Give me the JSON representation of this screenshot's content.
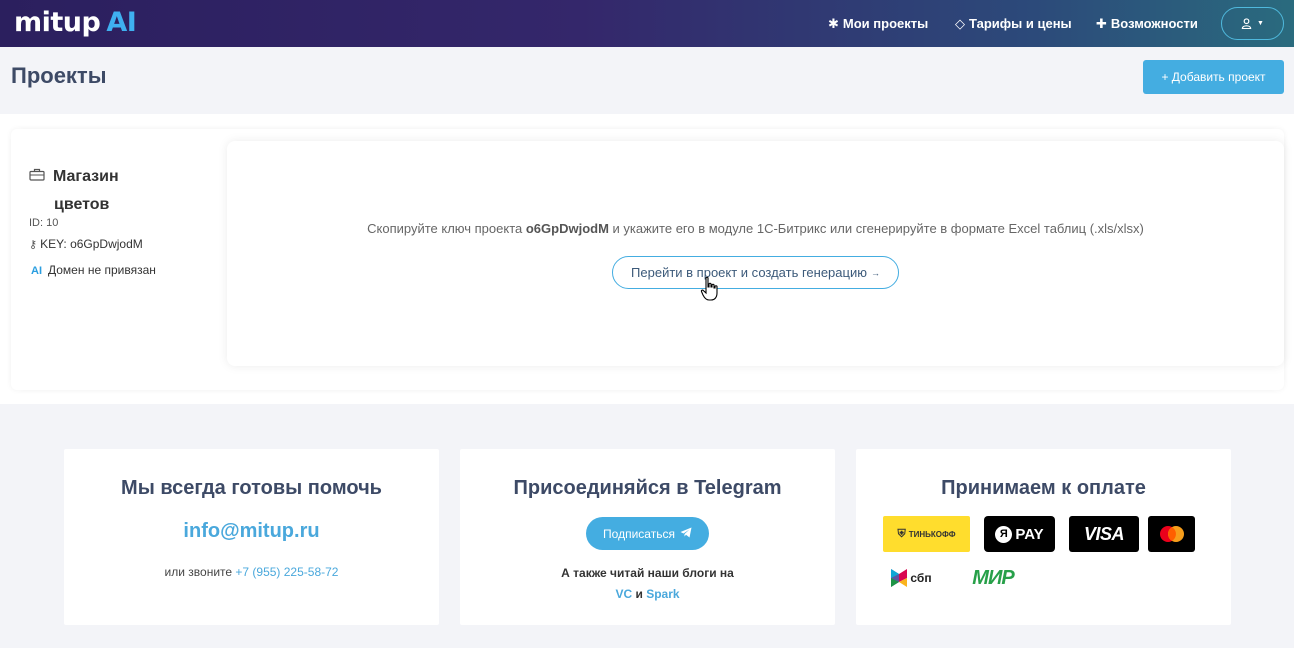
{
  "brand": {
    "name": "mitup",
    "suffix": "AI"
  },
  "nav": {
    "projects": {
      "icon": "asterisk-icon",
      "label": "Мои проекты"
    },
    "tariffs": {
      "icon": "diamond-icon",
      "label": "Тарифы и цены"
    },
    "features": {
      "icon": "plus-icon",
      "label": "Возможности"
    },
    "user_icon": "user-icon"
  },
  "page": {
    "title": "Проекты",
    "add_button": "+ Добавить проект"
  },
  "project": {
    "name_line1": "Магазин",
    "name_line2": "цветов",
    "id": "ID: 10",
    "key": "KEY: o6GpDwjodM",
    "domain_badge": "AI",
    "domain_status": "Домен не привязан",
    "instruction_before": "Скопируйте ключ проекта ",
    "instruction_key": "o6GpDwjodM",
    "instruction_after": " и укажите его в модуле 1С-Битрикс или сгенерируйте в формате Excel таблиц (.xls/xlsx)",
    "generate_button": "Перейти в проект и создать генерацию"
  },
  "footer": {
    "support": {
      "title": "Мы всегда готовы помочь",
      "email": "info@mitup.ru",
      "call_prefix": "или звоните ",
      "phone": "+7 (955) 225-58-72"
    },
    "telegram": {
      "title": "Присоединяйся в Telegram",
      "subscribe": "Подписаться",
      "blogs_text": "А также читай наши блоги на",
      "blog_vc": "VC",
      "and": "и",
      "blog_spark": "Spark"
    },
    "payment": {
      "title": "Принимаем к оплате",
      "tinkoff": "ТИНЬКОФФ",
      "ypay_letter": "Я",
      "ypay": "PAY",
      "visa": "VISA",
      "sbp": "сбп",
      "mir": "МИР"
    }
  },
  "colors": {
    "accent": "#44ade1",
    "title": "#3d4a66",
    "nav_start": "#2b1f5e",
    "nav_end": "#2a6b7e"
  }
}
